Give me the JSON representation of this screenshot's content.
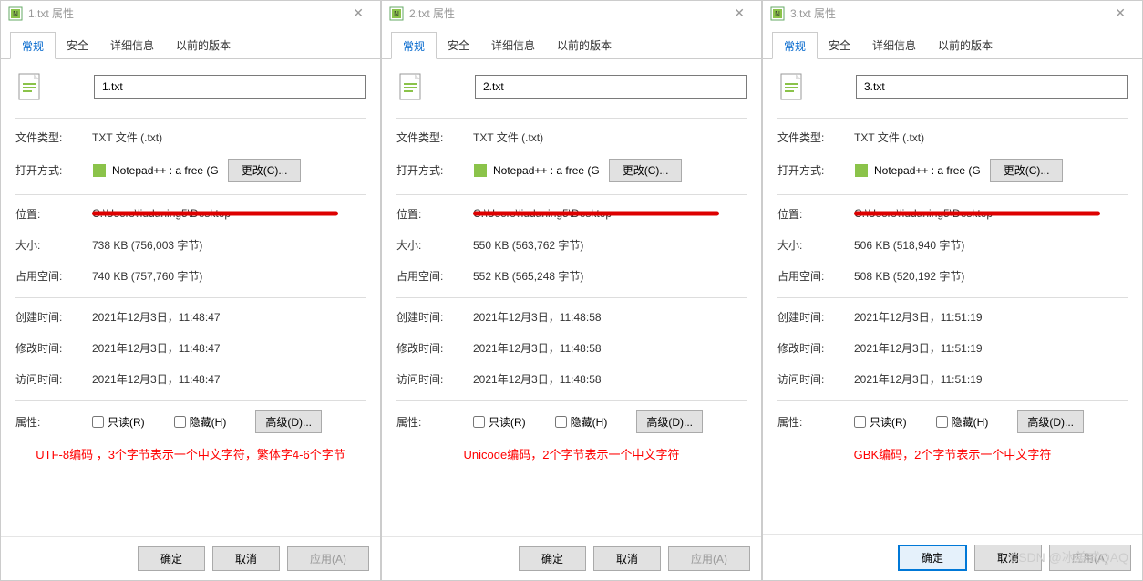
{
  "dialogs": [
    {
      "title": "1.txt 属性",
      "filename": "1.txt",
      "location": "C:\\Users\\liudaning5\\Desktop",
      "size": "738 KB (756,003 字节)",
      "disk_size": "740 KB (757,760 字节)",
      "created": "2021年12月3日，11:48:47",
      "modified": "2021年12月3日，11:48:47",
      "accessed": "2021年12月3日，11:48:47",
      "annotation": "UTF-8编码 ，3个字节表示一个中文字符，繁体字4-6个字节",
      "primary_btn": false
    },
    {
      "title": "2.txt 属性",
      "filename": "2.txt",
      "location": "C:\\Users\\liudaning5\\Desktop",
      "size": "550 KB (563,762 字节)",
      "disk_size": "552 KB (565,248 字节)",
      "created": "2021年12月3日，11:48:58",
      "modified": "2021年12月3日，11:48:58",
      "accessed": "2021年12月3日，11:48:58",
      "annotation": "Unicode编码，2个字节表示一个中文字符",
      "primary_btn": false
    },
    {
      "title": "3.txt 属性",
      "filename": "3.txt",
      "location": "C:\\Users\\liudaning5\\Desktop",
      "size": "506 KB (518,940 字节)",
      "disk_size": "508 KB (520,192 字节)",
      "created": "2021年12月3日，11:51:19",
      "modified": "2021年12月3日，11:51:19",
      "accessed": "2021年12月3日，11:51:19",
      "annotation": "GBK编码，2个字节表示一个中文字符",
      "primary_btn": true
    }
  ],
  "common": {
    "tabs": {
      "general": "常规",
      "security": "安全",
      "details": "详细信息",
      "previous": "以前的版本"
    },
    "labels": {
      "file_type": "文件类型:",
      "file_type_value": "TXT 文件 (.txt)",
      "opens_with": "打开方式:",
      "opens_with_value": "Notepad++ : a free (G",
      "change_btn": "更改(C)...",
      "location": "位置:",
      "size": "大小:",
      "disk_size": "占用空间:",
      "created": "创建时间:",
      "modified": "修改时间:",
      "accessed": "访问时间:",
      "attributes": "属性:",
      "readonly": "只读(R)",
      "hidden": "隐藏(H)",
      "advanced": "高级(D)..."
    },
    "footer": {
      "ok": "确定",
      "cancel": "取消",
      "apply": "应用(A)"
    }
  },
  "watermark": "CSDN @冰美式QAQ"
}
